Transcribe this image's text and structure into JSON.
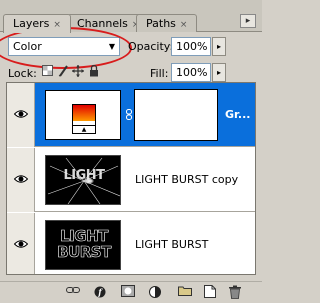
{
  "tabs": [
    {
      "label": "Layers",
      "close": "×"
    },
    {
      "label": "Channels",
      "close": "×"
    },
    {
      "label": "Paths",
      "close": "×"
    }
  ],
  "panel_menu_glyph": "▸",
  "blend_mode": {
    "value": "Color",
    "arrow": "▼"
  },
  "opacity": {
    "label": "Opacity:",
    "value": "100%",
    "arrow": "▸"
  },
  "lock": {
    "label": "Lock:",
    "icons": [
      "lock-transparent-icon",
      "lock-image-icon",
      "lock-position-icon",
      "lock-all-icon"
    ]
  },
  "fill": {
    "label": "Fill:",
    "value": "100%",
    "arrow": "▸"
  },
  "layers": [
    {
      "name": "Gr...",
      "type": "gradient-map-adjustment",
      "selected": true,
      "visible": true
    },
    {
      "name": "LIGHT BURST copy",
      "type": "raster",
      "selected": false,
      "visible": true,
      "thumb_text": "LIGHT"
    },
    {
      "name": "LIGHT BURST",
      "type": "raster",
      "selected": false,
      "visible": true,
      "thumb_text": [
        "LIGHT",
        "BURST"
      ]
    }
  ],
  "bottom_toolbar": [
    "link-layers-icon",
    "layer-style-icon",
    "add-mask-icon",
    "new-adjustment-icon",
    "new-group-icon",
    "new-layer-icon",
    "delete-layer-icon"
  ],
  "colors": {
    "selection": "#0a6fdc",
    "highlight_ellipse": "#d81c1c",
    "gradient_start": "#e00000",
    "gradient_end": "#ff9a00"
  }
}
